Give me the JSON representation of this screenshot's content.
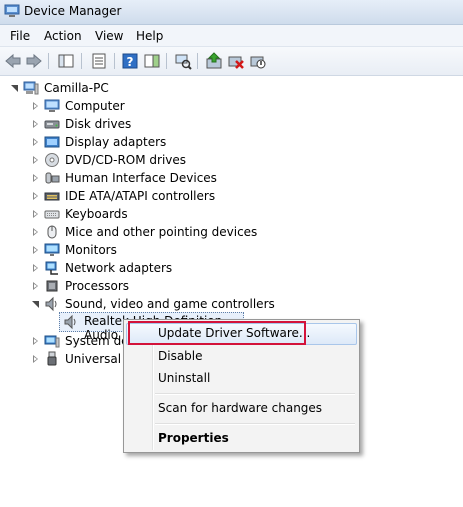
{
  "window": {
    "title": "Device Manager",
    "icon": "device-manager-icon"
  },
  "menubar": {
    "items": [
      "File",
      "Action",
      "View",
      "Help"
    ]
  },
  "tree": {
    "root": "Camilla-PC",
    "categories": [
      {
        "label": "Computer",
        "icon": "computer-icon"
      },
      {
        "label": "Disk drives",
        "icon": "disk-drive-icon"
      },
      {
        "label": "Display adapters",
        "icon": "display-adapter-icon"
      },
      {
        "label": "DVD/CD-ROM drives",
        "icon": "dvd-drive-icon"
      },
      {
        "label": "Human Interface Devices",
        "icon": "hid-icon"
      },
      {
        "label": "IDE ATA/ATAPI controllers",
        "icon": "ide-controller-icon"
      },
      {
        "label": "Keyboards",
        "icon": "keyboard-icon"
      },
      {
        "label": "Mice and other pointing devices",
        "icon": "mouse-icon"
      },
      {
        "label": "Monitors",
        "icon": "monitor-icon"
      },
      {
        "label": "Network adapters",
        "icon": "network-adapter-icon"
      },
      {
        "label": "Processors",
        "icon": "processor-icon"
      },
      {
        "label": "Sound, video and game controllers",
        "icon": "speaker-icon"
      },
      {
        "label": "System dev",
        "icon": "system-device-icon"
      },
      {
        "label": "Universal Se",
        "icon": "usb-icon"
      }
    ],
    "selected_child": "Realtek High Definition Audio"
  },
  "context_menu": {
    "items": [
      "Update Driver Software...",
      "Disable",
      "Uninstall",
      "Scan for hardware changes",
      "Properties"
    ]
  },
  "colors": {
    "highlight_border": "#d3123a",
    "menu_hover": "#dde9f8"
  }
}
